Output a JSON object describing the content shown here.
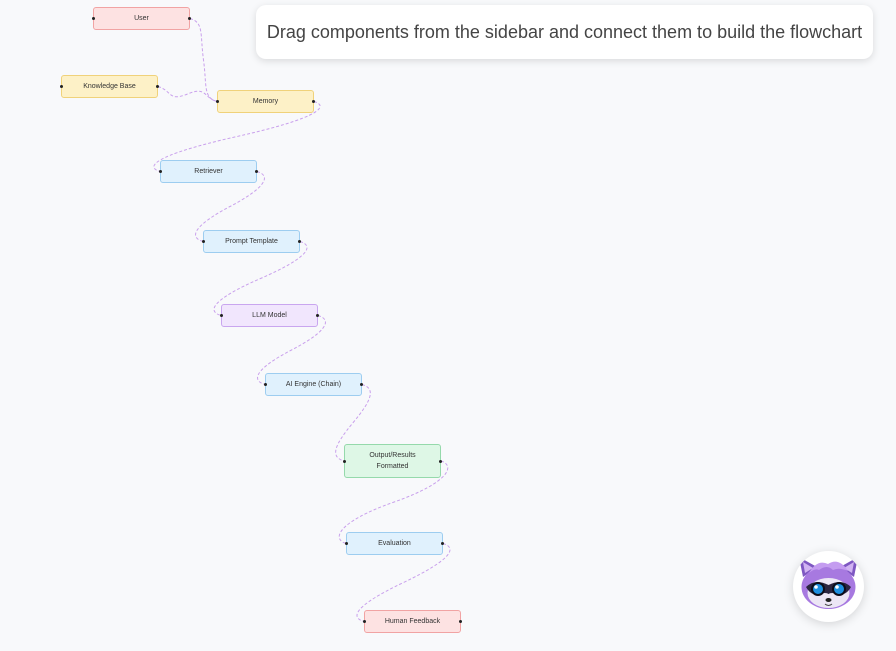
{
  "instruction": "Drag components from the sidebar and connect them to build the flowchart",
  "nodes": [
    {
      "id": "user",
      "label": "User",
      "color": "red"
    },
    {
      "id": "knowledge-base",
      "label": "Knowledge Base",
      "color": "yellow"
    },
    {
      "id": "memory",
      "label": "Memory",
      "color": "yellow"
    },
    {
      "id": "retriever",
      "label": "Retriever",
      "color": "blue"
    },
    {
      "id": "prompt-template",
      "label": "Prompt Template",
      "color": "blue"
    },
    {
      "id": "llm-model",
      "label": "LLM Model",
      "color": "purple"
    },
    {
      "id": "ai-engine",
      "label": "AI Engine (Chain)",
      "color": "blue"
    },
    {
      "id": "output-results",
      "label": "Output/Results\nFormatted",
      "color": "green"
    },
    {
      "id": "evaluation",
      "label": "Evaluation",
      "color": "blue"
    },
    {
      "id": "human-feedback",
      "label": "Human Feedback",
      "color": "red"
    }
  ],
  "edges": [
    [
      "user",
      "memory"
    ],
    [
      "knowledge-base",
      "memory"
    ],
    [
      "memory",
      "retriever"
    ],
    [
      "retriever",
      "prompt-template"
    ],
    [
      "prompt-template",
      "llm-model"
    ],
    [
      "llm-model",
      "ai-engine"
    ],
    [
      "ai-engine",
      "output-results"
    ],
    [
      "output-results",
      "evaluation"
    ],
    [
      "evaluation",
      "human-feedback"
    ]
  ],
  "colors": {
    "edge": "#c9a0ec",
    "background": "#f8f9fb"
  },
  "avatar": {
    "icon": "raccoon-mascot-icon"
  }
}
